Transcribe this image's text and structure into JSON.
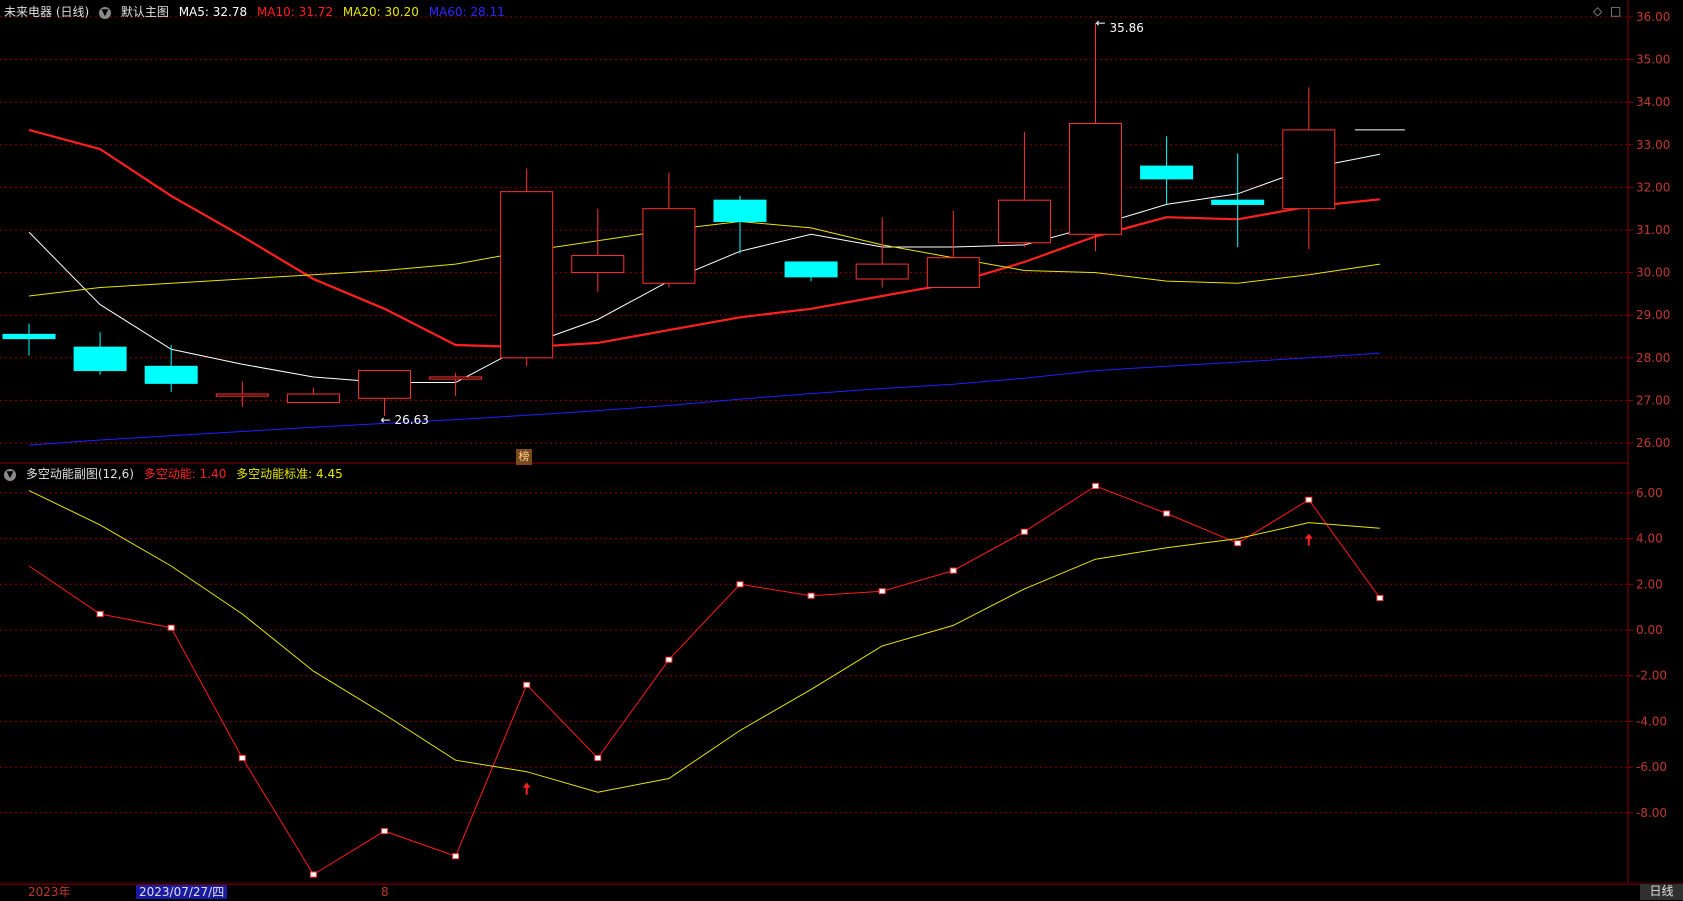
{
  "header": {
    "stock_name": "未来电器 (日线)",
    "main_chart_label": "默认主图",
    "ma5_label": "MA5: 32.78",
    "ma10_label": "MA10: 31.72",
    "ma20_label": "MA20: 30.20",
    "ma60_label": "MA60: 28.11",
    "ma5_color": "#ffffff",
    "ma10_color": "#ff2020",
    "ma20_color": "#e6e600",
    "ma60_color": "#2020ff"
  },
  "indicator_header": {
    "name": "多空动能副图(12,6)",
    "line1_label": "多空动能: 1.40",
    "line2_label": "多空动能标准: 4.45"
  },
  "marker_label": "榜",
  "bottom_bar": {
    "year_label": "2023年",
    "date_label": "2023/07/27/四",
    "month_label": "8",
    "period_label": "日线"
  },
  "colors": {
    "background": "#000000",
    "up_candle": "#ff3232",
    "down_candle": "#00ffff",
    "grid": "#8b0000",
    "axis_text": "#c0392b"
  },
  "chart_data": [
    {
      "type": "candlestick",
      "title": "未来电器 (日线)",
      "ylim": [
        25.7,
        36.1
      ],
      "y_ticks": [
        "26.00",
        "27.00",
        "28.00",
        "29.00",
        "30.00",
        "31.00",
        "32.00",
        "33.00",
        "34.00",
        "35.00",
        "36.00"
      ],
      "candles": [
        {
          "o": 28.55,
          "h": 28.8,
          "l": 28.05,
          "c": 28.45
        },
        {
          "o": 28.25,
          "h": 28.6,
          "l": 27.6,
          "c": 27.7
        },
        {
          "o": 27.8,
          "h": 28.3,
          "l": 27.2,
          "c": 27.4
        },
        {
          "o": 27.1,
          "h": 27.45,
          "l": 26.85,
          "c": 27.15
        },
        {
          "o": 26.95,
          "h": 27.3,
          "l": 26.95,
          "c": 27.15
        },
        {
          "o": 27.05,
          "h": 27.7,
          "l": 26.63,
          "c": 27.7
        },
        {
          "o": 27.5,
          "h": 27.65,
          "l": 27.1,
          "c": 27.55
        },
        {
          "o": 28.0,
          "h": 32.45,
          "l": 27.8,
          "c": 31.9
        },
        {
          "o": 30.0,
          "h": 31.5,
          "l": 29.55,
          "c": 30.4
        },
        {
          "o": 29.75,
          "h": 32.35,
          "l": 29.65,
          "c": 31.5
        },
        {
          "o": 31.7,
          "h": 31.8,
          "l": 30.45,
          "c": 31.2
        },
        {
          "o": 30.25,
          "h": 30.25,
          "l": 29.8,
          "c": 29.9
        },
        {
          "o": 29.85,
          "h": 31.3,
          "l": 29.65,
          "c": 30.2
        },
        {
          "o": 29.65,
          "h": 31.45,
          "l": 29.65,
          "c": 30.35
        },
        {
          "o": 30.7,
          "h": 33.3,
          "l": 30.6,
          "c": 31.7
        },
        {
          "o": 30.9,
          "h": 35.86,
          "l": 30.5,
          "c": 33.5
        },
        {
          "o": 32.5,
          "h": 33.2,
          "l": 31.6,
          "c": 32.2
        },
        {
          "o": 31.7,
          "h": 32.8,
          "l": 30.6,
          "c": 31.6
        },
        {
          "o": 31.5,
          "h": 34.35,
          "l": 30.55,
          "c": 33.35
        }
      ],
      "last_tick": 33.35,
      "high_annotation": {
        "value": 35.86,
        "label": "35.86"
      },
      "low_annotation": {
        "value": 26.63,
        "label": "26.63"
      },
      "series": [
        {
          "name": "MA5",
          "values": [
            30.95,
            29.25,
            28.2,
            27.85,
            27.55,
            27.42,
            27.42,
            28.3,
            28.9,
            29.8,
            30.5,
            30.9,
            30.6,
            30.6,
            30.65,
            31.1,
            31.6,
            31.85,
            32.45,
            32.78
          ]
        },
        {
          "name": "MA10",
          "values": [
            33.35,
            32.9,
            31.8,
            30.85,
            29.85,
            29.15,
            28.3,
            28.25,
            28.35,
            28.65,
            28.95,
            29.15,
            29.45,
            29.75,
            30.25,
            30.85,
            31.3,
            31.25,
            31.55,
            31.72
          ]
        },
        {
          "name": "MA20",
          "values": [
            29.45,
            29.65,
            29.75,
            29.85,
            29.95,
            30.05,
            30.2,
            30.5,
            30.75,
            31.0,
            31.2,
            31.05,
            30.65,
            30.35,
            30.05,
            30.0,
            29.8,
            29.75,
            29.95,
            30.2
          ]
        },
        {
          "name": "MA60",
          "values": [
            25.95,
            26.07,
            26.17,
            26.27,
            26.37,
            26.46,
            26.55,
            26.65,
            26.76,
            26.88,
            27.03,
            27.16,
            27.28,
            27.38,
            27.52,
            27.7,
            27.8,
            27.9,
            28.0,
            28.11
          ]
        }
      ]
    },
    {
      "type": "line",
      "title": "多空动能副图(12,6)",
      "ylim": [
        -10.8,
        7.0
      ],
      "y_ticks": [
        "6.00",
        "4.00",
        "2.00",
        "0.00",
        "-2.00",
        "-4.00",
        "-6.00",
        "-8.00"
      ],
      "series": [
        {
          "name": "多空动能",
          "values": [
            2.8,
            0.7,
            0.1,
            -5.6,
            -10.7,
            -8.8,
            -9.9,
            -2.4,
            -5.6,
            -1.3,
            2.0,
            1.5,
            1.7,
            2.6,
            4.3,
            6.3,
            5.1,
            3.8,
            5.7,
            1.4
          ]
        },
        {
          "name": "多空动能标准",
          "values": [
            6.1,
            4.6,
            2.8,
            0.7,
            -1.8,
            -3.7,
            -5.7,
            -6.2,
            -7.1,
            -6.5,
            -4.4,
            -2.6,
            -0.7,
            0.2,
            1.8,
            3.1,
            3.6,
            4.0,
            4.7,
            4.45
          ]
        }
      ],
      "up_arrows_at": [
        7,
        18
      ]
    }
  ]
}
